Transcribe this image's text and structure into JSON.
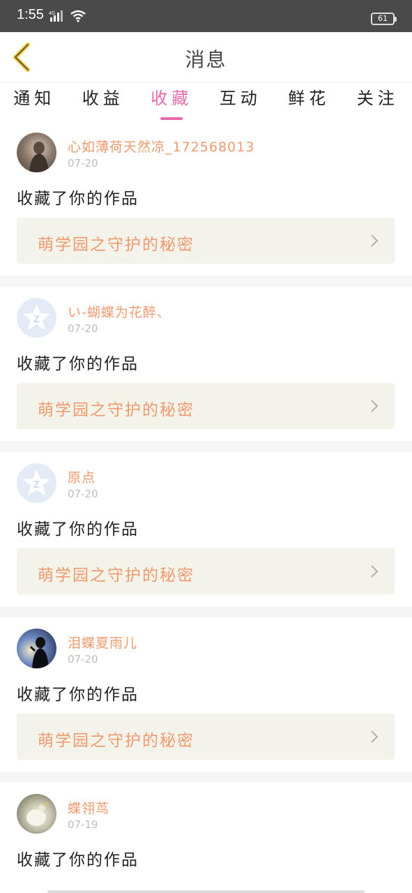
{
  "status_bar": {
    "time": "1:55",
    "network": "4G",
    "battery": "61"
  },
  "navbar": {
    "title": "消息",
    "back_icon": "chevron-left-icon",
    "accent": "#e8c53a"
  },
  "tabs": [
    {
      "label": "通知",
      "active": false
    },
    {
      "label": "收益",
      "active": false
    },
    {
      "label": "收藏",
      "active": true
    },
    {
      "label": "互动",
      "active": false
    },
    {
      "label": "鲜花",
      "active": false
    },
    {
      "label": "关注",
      "active": false
    }
  ],
  "colors": {
    "active_tab": "#e56ba8",
    "username": "#ef9a6e",
    "work_title": "#ef9a6e",
    "work_bg": "#f4f3ea"
  },
  "messages": [
    {
      "username": "心如薄荷天然凉_172568013",
      "date": "07-20",
      "action": "收藏了你的作品",
      "work_title": "萌学园之守护的秘密",
      "avatar": "photo"
    },
    {
      "username": "い-蝴蝶为花醉、",
      "date": "07-20",
      "action": "收藏了你的作品",
      "work_title": "萌学园之守护的秘密",
      "avatar": "default-star"
    },
    {
      "username": "原点",
      "date": "07-20",
      "action": "收藏了你的作品",
      "work_title": "萌学园之守护的秘密",
      "avatar": "default-star"
    },
    {
      "username": "泪蝶夏雨儿",
      "date": "07-20",
      "action": "收藏了你的作品",
      "work_title": "萌学园之守护的秘密",
      "avatar": "photo"
    },
    {
      "username": "蝶翎茑",
      "date": "07-19",
      "action": "收藏了你的作品",
      "avatar": "photo"
    }
  ]
}
